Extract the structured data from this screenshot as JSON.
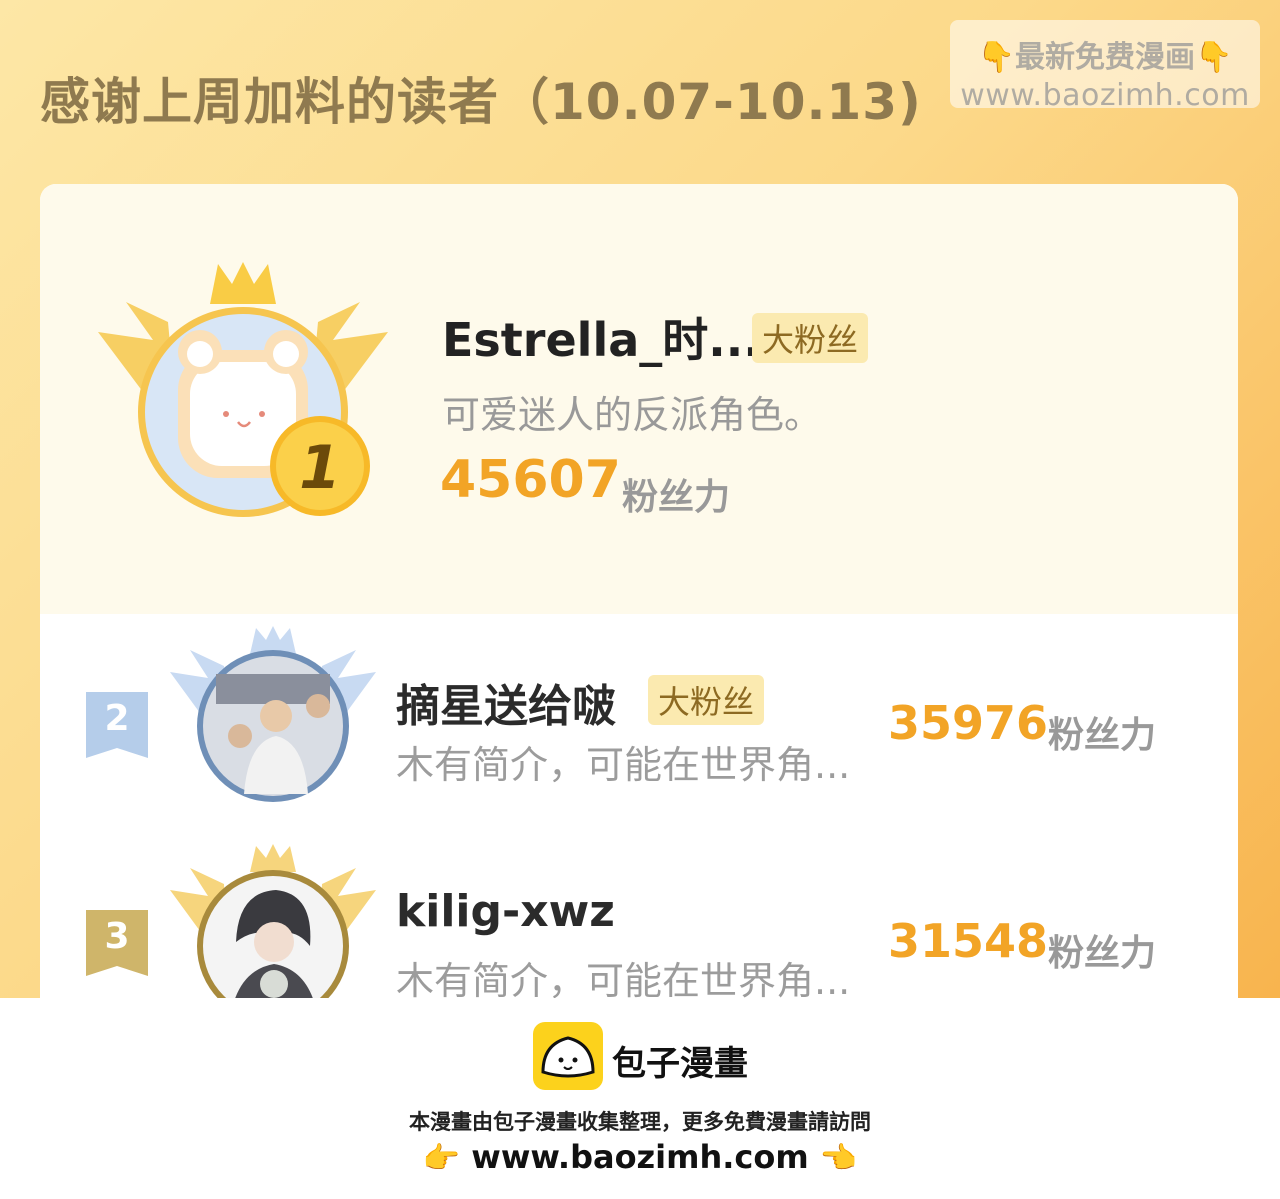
{
  "header": {
    "title": "感谢上周加料的读者（10.07-10.13)"
  },
  "watermark": {
    "line1": "最新免费漫画",
    "line2": "www.baozimh.com",
    "hand_left": "👇",
    "hand_right": "👇"
  },
  "leaderboard": {
    "first": {
      "rank": "1",
      "name": "Estrella_时...",
      "tag": "大粉丝",
      "bio": "可爱迷人的反派角色。",
      "score": "45607",
      "unit": "粉丝力"
    },
    "rows": [
      {
        "rank": "2",
        "name": "摘星送给啵",
        "tag": "大粉丝",
        "bio": "木有简介，可能在世界角...",
        "score": "35976",
        "unit": "粉丝力"
      },
      {
        "rank": "3",
        "name": "kilig-xwz",
        "bio": "木有简介，可能在世界角...",
        "score": "31548",
        "unit": "粉丝力"
      }
    ]
  },
  "footer": {
    "logo_text": "包子漫畫",
    "line1": "本漫畫由包子漫畫收集整理，更多免費漫畫請訪問",
    "url": "www.baozimh.com",
    "hand_left": "👉",
    "hand_right": "👈"
  },
  "colors": {
    "accent": "#f2a426",
    "tag_bg": "#fbeab0",
    "title": "#8f7a4f"
  }
}
